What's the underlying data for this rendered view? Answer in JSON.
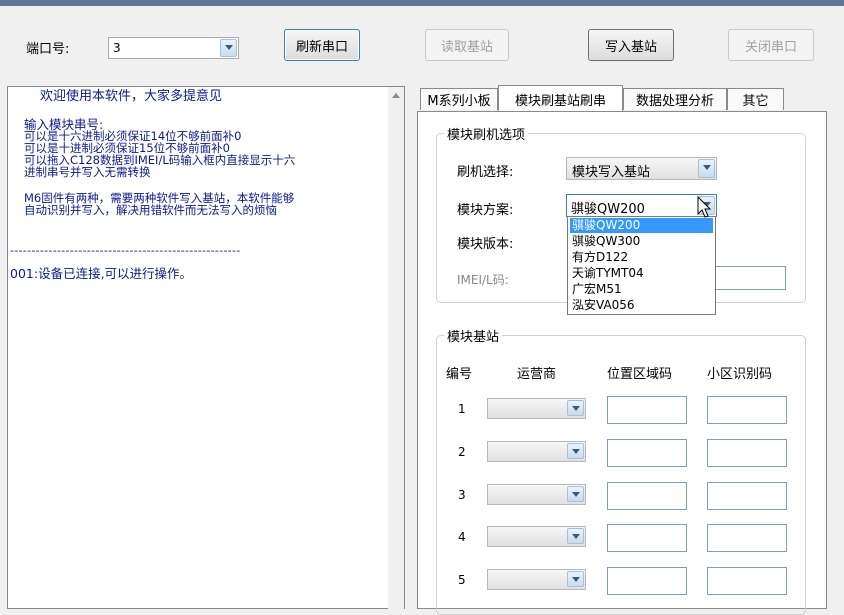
{
  "toolbar": {
    "port_label": "端口号:",
    "port_value": "3",
    "refresh_label": "刷新串口",
    "read_label": "读取基站",
    "write_label": "写入基站",
    "close_label": "关闭串口"
  },
  "log": {
    "lines": [
      "欢迎使用本软件，大家多提意见",
      "输入模块串号:",
      "可以是十六进制必须保证14位不够前面补0",
      "可以是十进制必须保证15位不够前面补0",
      "可以拖入C128数据到IMEI/L码输入框内直接显示十六",
      "进制串号并写入无需转换",
      "M6固件有两种，需要两种软件写入基站，本软件能够",
      "自动识别并写入，解决用错软件而无法写入的烦恼"
    ],
    "separator": "------------------------------------------------------",
    "status": "001:设备已连接,可以进行操作。"
  },
  "tabs": [
    "M系列小板",
    "模块刷基站刷串",
    "数据处理分析",
    "其它"
  ],
  "flash": {
    "group_title": "模块刷机选项",
    "select_label": "刷机选择:",
    "select_value": "模块写入基站",
    "scheme_label": "模块方案:",
    "scheme_value": "骐骏QW200",
    "version_label": "模块版本:",
    "imei_label": "IMEI/L码:",
    "options": [
      "骐骏QW200",
      "骐骏QW300",
      "有方D122",
      "天谕TYMT04",
      "广宏M51",
      "泓安VA056"
    ]
  },
  "station": {
    "group_title": "模块基站",
    "headers": [
      "编号",
      "运营商",
      "位置区域码",
      "小区识别码"
    ],
    "rows": [
      "1",
      "2",
      "3",
      "4",
      "5"
    ]
  },
  "colors": {
    "selection": "#3399ff",
    "log_text": "#0a1a8c",
    "title_bar": "#5e7593"
  }
}
